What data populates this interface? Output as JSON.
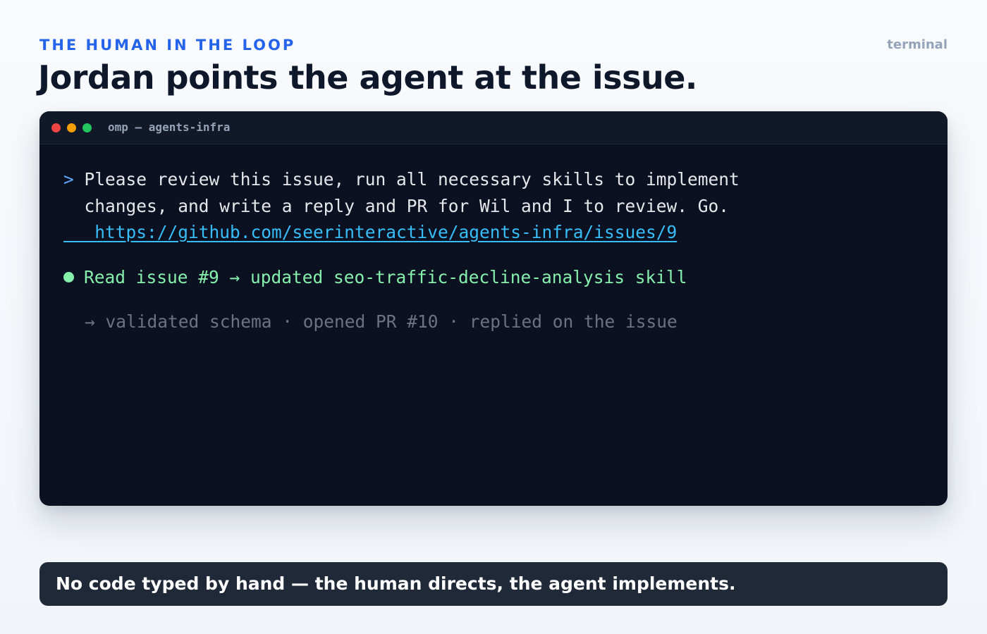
{
  "header": {
    "eyebrow": "THE HUMAN IN THE LOOP",
    "context_label": "terminal",
    "title": "Jordan points the agent at the issue."
  },
  "terminal": {
    "window_title": "omp — agents-infra",
    "window_controls": [
      "close-dot",
      "minimize-dot",
      "maximize-dot"
    ],
    "prompt_symbol": ">",
    "prompt_line_1": "Please review this issue, run all necessary skills to implement",
    "prompt_line_2": "  changes, and write a reply and PR for Wil and I to review. Go.",
    "prompt_link": "   https://github.com/seerinteractive/agents-infra/issues/9",
    "status_line": "Read issue #9 → updated seo-traffic-decline-analysis skill",
    "detail_line": "→ validated schema · opened PR #10 · replied on the issue"
  },
  "caption": {
    "text": "No code typed by hand — the human directs, the agent implements."
  },
  "colors": {
    "accent": "#2563eb",
    "terminal_bg": "#0b1120",
    "link": "#38bdf8",
    "success": "#86efac",
    "muted": "#6b7280"
  }
}
